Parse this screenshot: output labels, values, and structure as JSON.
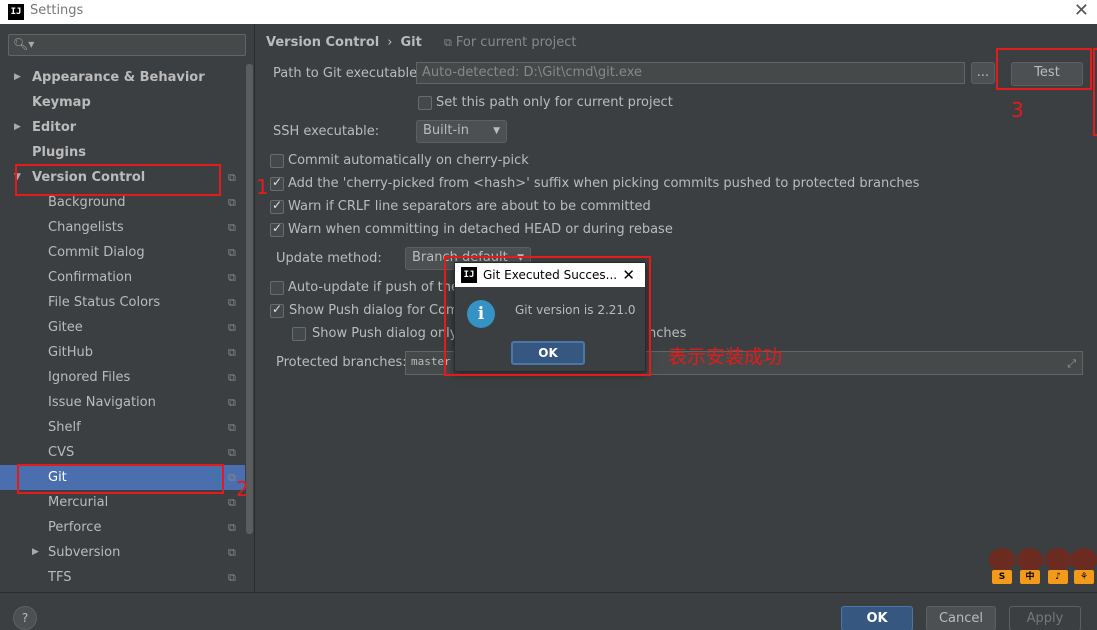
{
  "window": {
    "title": "Settings",
    "app_icon": "IJ"
  },
  "sidebar": {
    "search_placeholder": "",
    "items": [
      {
        "label": "Appearance & Behavior",
        "level": 0,
        "arrow": "▶",
        "copy": false
      },
      {
        "label": "Keymap",
        "level": 0,
        "arrow": "",
        "copy": false
      },
      {
        "label": "Editor",
        "level": 0,
        "arrow": "▶",
        "copy": false
      },
      {
        "label": "Plugins",
        "level": 0,
        "arrow": "",
        "copy": false
      },
      {
        "label": "Version Control",
        "level": 0,
        "arrow": "▼",
        "copy": true
      },
      {
        "label": "Background",
        "level": 1,
        "arrow": "",
        "copy": true
      },
      {
        "label": "Changelists",
        "level": 1,
        "arrow": "",
        "copy": true
      },
      {
        "label": "Commit Dialog",
        "level": 1,
        "arrow": "",
        "copy": true
      },
      {
        "label": "Confirmation",
        "level": 1,
        "arrow": "",
        "copy": true
      },
      {
        "label": "File Status Colors",
        "level": 1,
        "arrow": "",
        "copy": true
      },
      {
        "label": "Gitee",
        "level": 1,
        "arrow": "",
        "copy": true
      },
      {
        "label": "GitHub",
        "level": 1,
        "arrow": "",
        "copy": true
      },
      {
        "label": "Ignored Files",
        "level": 1,
        "arrow": "",
        "copy": true
      },
      {
        "label": "Issue Navigation",
        "level": 1,
        "arrow": "",
        "copy": true
      },
      {
        "label": "Shelf",
        "level": 1,
        "arrow": "",
        "copy": true
      },
      {
        "label": "CVS",
        "level": 1,
        "arrow": "",
        "copy": true
      },
      {
        "label": "Git",
        "level": 1,
        "arrow": "",
        "copy": true,
        "selected": true
      },
      {
        "label": "Mercurial",
        "level": 1,
        "arrow": "",
        "copy": true
      },
      {
        "label": "Perforce",
        "level": 1,
        "arrow": "",
        "copy": true
      },
      {
        "label": "Subversion",
        "level": 1,
        "arrow": "▶",
        "copy": true
      },
      {
        "label": "TFS",
        "level": 1,
        "arrow": "",
        "copy": true
      }
    ]
  },
  "main": {
    "breadcrumb": [
      "Version Control",
      "Git"
    ],
    "breadcrumb_sep": "›",
    "for_project": "For current project",
    "path_label": "Path to Git executable:",
    "path_value": "Auto-detected: D:\\Git\\cmd\\git.exe",
    "browse_label": "...",
    "test_label": "Test",
    "path_only_label": "Set this path only for current project",
    "ssh_label": "SSH executable:",
    "ssh_value": "Built-in",
    "checks": [
      {
        "label": "Commit automatically on cherry-pick",
        "checked": false
      },
      {
        "label": "Add the 'cherry-picked from <hash>' suffix when picking commits pushed to protected branches",
        "checked": true
      },
      {
        "label": "Warn if CRLF line separators are about to be committed",
        "checked": true
      },
      {
        "label": "Warn when committing in detached HEAD or during rebase",
        "checked": true
      }
    ],
    "update_method_label": "Update method:",
    "update_method_value": "Branch default",
    "auto_update_label": "Auto-update if push of the c",
    "show_push_label": "Show Push dialog for Comm",
    "show_push_only_label": "Show Push dialog only w",
    "show_push_only_tail": "nches",
    "protected_label": "Protected branches:",
    "protected_value": "master"
  },
  "dialog": {
    "title": "Git Executed Succes...",
    "message": "Git version is 2.21.0",
    "ok_label": "OK"
  },
  "annotations": {
    "n1": "1",
    "n2": "2",
    "n3": "3",
    "note": "表示安装成功"
  },
  "footer": {
    "help": "?",
    "ok": "OK",
    "cancel": "Cancel",
    "apply": "Apply"
  },
  "mascots": [
    "S",
    "中",
    "♪",
    "⚘"
  ]
}
